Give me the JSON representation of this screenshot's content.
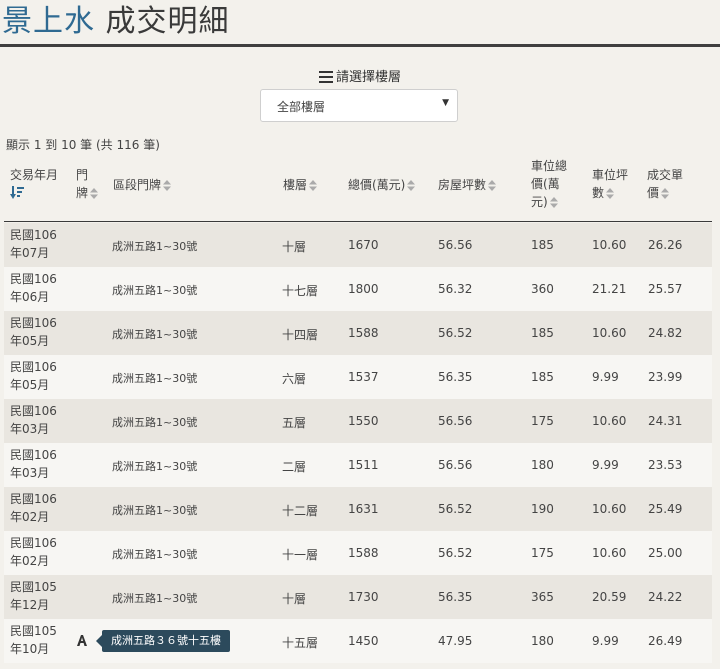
{
  "page": {
    "title_brand": "景上水",
    "title_rest": "成交明細"
  },
  "filter": {
    "label": "請選擇樓層",
    "selected": "全部樓層"
  },
  "summary": "顯示 1 到 10 筆 (共 116 筆)",
  "columns": {
    "date": [
      "交易年月"
    ],
    "door": [
      "門",
      "牌"
    ],
    "addr": [
      "區段門牌"
    ],
    "floor": [
      "樓層"
    ],
    "price": [
      "總價(萬元)"
    ],
    "area": [
      "房屋坪數"
    ],
    "park": [
      "車位總",
      "價(萬",
      "元)"
    ],
    "parkarea": [
      "車位坪",
      "數"
    ],
    "unit": [
      "成交單",
      "價"
    ]
  },
  "rows": [
    {
      "date": [
        "民國106",
        "年07月"
      ],
      "addr": "成洲五路1~30號",
      "floor": "十層",
      "price": "1670",
      "area": "56.56",
      "park": "185",
      "parkarea": "10.60",
      "unit": "26.26"
    },
    {
      "date": [
        "民國106",
        "年06月"
      ],
      "addr": "成洲五路1~30號",
      "floor": "十七層",
      "price": "1800",
      "area": "56.32",
      "park": "360",
      "parkarea": "21.21",
      "unit": "25.57"
    },
    {
      "date": [
        "民國106",
        "年05月"
      ],
      "addr": "成洲五路1~30號",
      "floor": "十四層",
      "price": "1588",
      "area": "56.52",
      "park": "185",
      "parkarea": "10.60",
      "unit": "24.82"
    },
    {
      "date": [
        "民國106",
        "年05月"
      ],
      "addr": "成洲五路1~30號",
      "floor": "六層",
      "price": "1537",
      "area": "56.35",
      "park": "185",
      "parkarea": "9.99",
      "unit": "23.99"
    },
    {
      "date": [
        "民國106",
        "年03月"
      ],
      "addr": "成洲五路1~30號",
      "floor": "五層",
      "price": "1550",
      "area": "56.56",
      "park": "175",
      "parkarea": "10.60",
      "unit": "24.31"
    },
    {
      "date": [
        "民國106",
        "年03月"
      ],
      "addr": "成洲五路1~30號",
      "floor": "二層",
      "price": "1511",
      "area": "56.56",
      "park": "180",
      "parkarea": "9.99",
      "unit": "23.53"
    },
    {
      "date": [
        "民國106",
        "年02月"
      ],
      "addr": "成洲五路1~30號",
      "floor": "十二層",
      "price": "1631",
      "area": "56.52",
      "park": "190",
      "parkarea": "10.60",
      "unit": "25.49"
    },
    {
      "date": [
        "民國106",
        "年02月"
      ],
      "addr": "成洲五路1~30號",
      "floor": "十一層",
      "price": "1588",
      "area": "56.52",
      "park": "175",
      "parkarea": "10.60",
      "unit": "25.00"
    },
    {
      "date": [
        "民國105",
        "年12月"
      ],
      "addr": "成洲五路1~30號",
      "floor": "十層",
      "price": "1730",
      "area": "56.35",
      "park": "365",
      "parkarea": "20.59",
      "unit": "24.22"
    },
    {
      "date": [
        "民國105",
        "年10月"
      ],
      "addr": "",
      "floor": "十五層",
      "price": "1450",
      "area": "47.95",
      "park": "180",
      "parkarea": "9.99",
      "unit": "26.49",
      "door_icon": "door-plate-icon"
    }
  ],
  "tooltip": "成洲五路３６號十五樓",
  "colors": {
    "brand": "#2f6a92",
    "sort_active": "#2f6a92",
    "tooltip_bg": "#2c4a5c"
  }
}
